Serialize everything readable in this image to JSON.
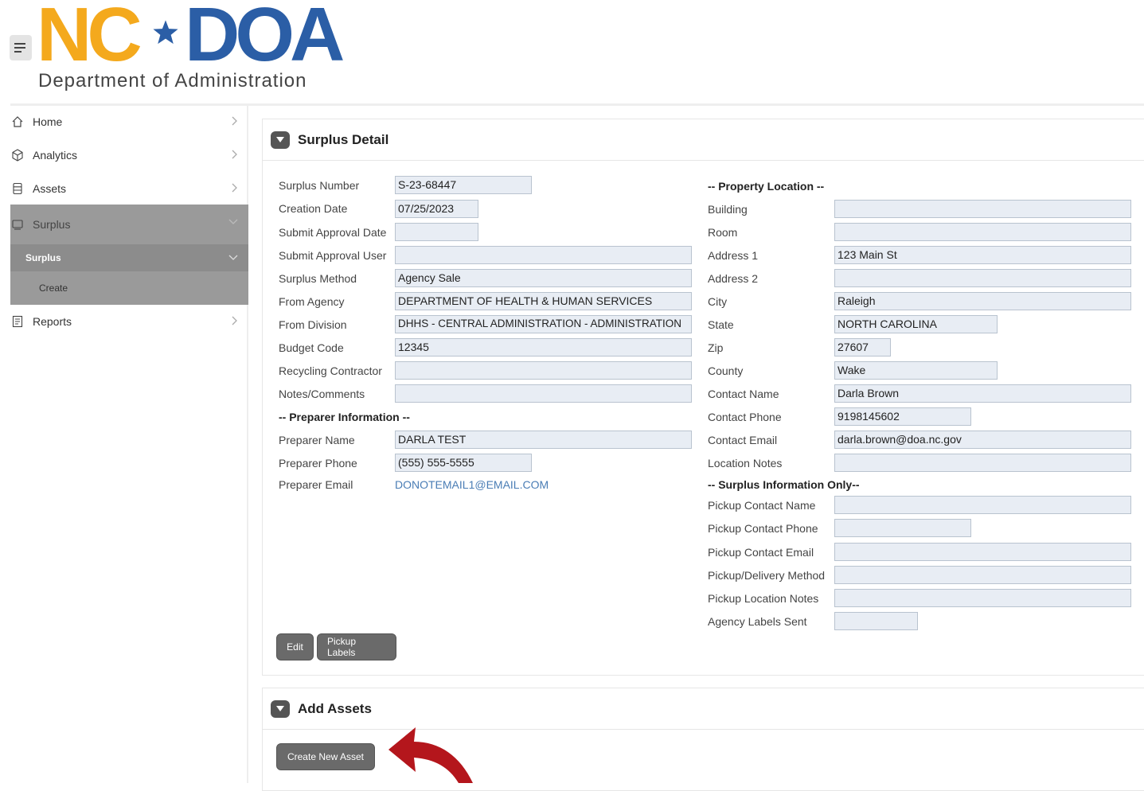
{
  "header": {
    "logo_nc": "NC",
    "logo_doa": "DOA",
    "logo_subtitle": "Department of Administration"
  },
  "sidebar": {
    "items": [
      {
        "label": "Home",
        "icon": "home-icon"
      },
      {
        "label": "Analytics",
        "icon": "cube-icon"
      },
      {
        "label": "Assets",
        "icon": "database-icon"
      },
      {
        "label": "Surplus",
        "icon": "surplus-icon"
      },
      {
        "label": "Reports",
        "icon": "report-icon"
      }
    ],
    "surplus_sub": "Surplus",
    "surplus_create": "Create"
  },
  "surplus_detail": {
    "title": "Surplus Detail",
    "left": {
      "surplus_number_label": "Surplus Number",
      "surplus_number": "S-23-68447",
      "creation_date_label": "Creation Date",
      "creation_date": "07/25/2023",
      "submit_approval_date_label": "Submit Approval Date",
      "submit_approval_date": "",
      "submit_approval_user_label": "Submit Approval User",
      "submit_approval_user": "",
      "surplus_method_label": "Surplus Method",
      "surplus_method": "Agency Sale",
      "from_agency_label": "From Agency",
      "from_agency": "DEPARTMENT OF HEALTH & HUMAN SERVICES",
      "from_division_label": "From Division",
      "from_division": "DHHS - CENTRAL ADMINISTRATION - ADMINISTRATION",
      "budget_code_label": "Budget Code",
      "budget_code": "12345",
      "recycling_contractor_label": "Recycling Contractor",
      "recycling_contractor": "",
      "notes_label": "Notes/Comments",
      "notes": "",
      "preparer_section": "-- Preparer Information --",
      "preparer_name_label": "Preparer Name",
      "preparer_name": "DARLA TEST",
      "preparer_phone_label": "Preparer Phone",
      "preparer_phone": "(555) 555-5555",
      "preparer_email_label": "Preparer Email",
      "preparer_email": "DONOTEMAIL1@EMAIL.COM"
    },
    "right": {
      "property_section": "-- Property Location --",
      "building_label": "Building",
      "building": "",
      "room_label": "Room",
      "room": "",
      "address1_label": "Address 1",
      "address1": "123 Main St",
      "address2_label": "Address 2",
      "address2": "",
      "city_label": "City",
      "city": "Raleigh",
      "state_label": "State",
      "state": "NORTH CAROLINA",
      "zip_label": "Zip",
      "zip": "27607",
      "county_label": "County",
      "county": "Wake",
      "contact_name_label": "Contact Name",
      "contact_name": "Darla Brown",
      "contact_phone_label": "Contact Phone",
      "contact_phone": "9198145602",
      "contact_email_label": "Contact Email",
      "contact_email": "darla.brown@doa.nc.gov",
      "location_notes_label": "Location Notes",
      "location_notes": "",
      "surplus_info_section": "-- Surplus Information Only--",
      "pickup_contact_name_label": "Pickup Contact Name",
      "pickup_contact_name": "",
      "pickup_contact_phone_label": "Pickup Contact Phone",
      "pickup_contact_phone": "",
      "pickup_contact_email_label": "Pickup Contact Email",
      "pickup_contact_email": "",
      "pickup_delivery_method_label": "Pickup/Delivery Method",
      "pickup_delivery_method": "",
      "pickup_location_notes_label": "Pickup Location Notes",
      "pickup_location_notes": "",
      "agency_labels_sent_label": "Agency Labels Sent",
      "agency_labels_sent": ""
    },
    "edit_button": "Edit",
    "pickup_labels_button": "Pickup Labels"
  },
  "add_assets": {
    "title": "Add Assets",
    "create_button": "Create New Asset"
  },
  "colors": {
    "nc_orange": "#f4a91d",
    "doa_blue": "#2b5ea6",
    "arrow_red": "#b4161c",
    "sidebar_active": "#9a9a9a",
    "field_bg": "#e8edf4"
  }
}
